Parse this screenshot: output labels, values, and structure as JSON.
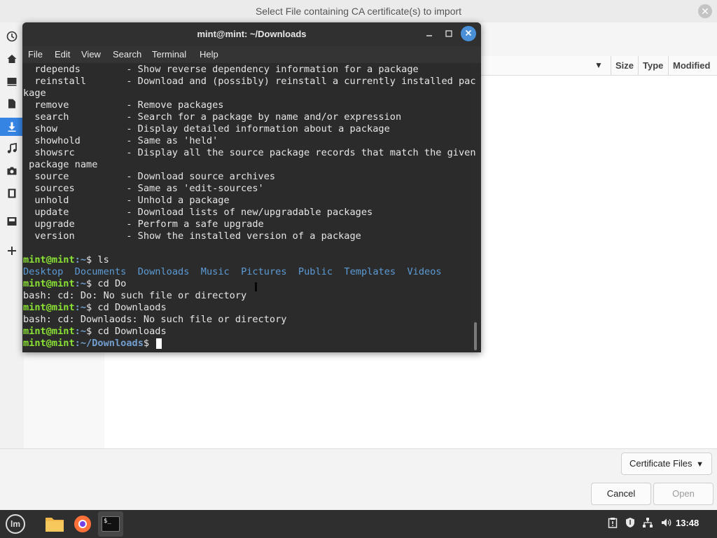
{
  "file_dialog": {
    "title": "Select File containing CA certificate(s) to import",
    "close_glyph": "✕",
    "sidebar_icons": [
      "recent-icon",
      "home-icon",
      "desktop-icon",
      "documents-icon",
      "downloads-icon",
      "music-icon",
      "pictures-icon",
      "videos-icon",
      "drive-icon",
      "plus-icon"
    ],
    "sidebar_active_index": 4,
    "columns": [
      "Size",
      "Type",
      "Modified"
    ],
    "filter_label": "Certificate Files",
    "cancel_label": "Cancel",
    "open_label": "Open"
  },
  "terminal": {
    "title": "mint@mint: ~/Downloads",
    "menu": [
      "File",
      "Edit",
      "View",
      "Search",
      "Terminal",
      "Help"
    ],
    "lines": [
      [
        {
          "t": "  rdepends        - Show reverse dependency information for a package",
          "c": ""
        }
      ],
      [
        {
          "t": "  reinstall       - Download and (possibly) reinstall a currently installed pac",
          "c": ""
        }
      ],
      [
        {
          "t": "kage",
          "c": ""
        }
      ],
      [
        {
          "t": "  remove          - Remove packages",
          "c": ""
        }
      ],
      [
        {
          "t": "  search          - Search for a package by name and/or expression",
          "c": ""
        }
      ],
      [
        {
          "t": "  show            - Display detailed information about a package",
          "c": ""
        }
      ],
      [
        {
          "t": "  showhold        - Same as 'held'",
          "c": ""
        }
      ],
      [
        {
          "t": "  showsrc         - Display all the source package records that match the given",
          "c": ""
        }
      ],
      [
        {
          "t": " package name",
          "c": ""
        }
      ],
      [
        {
          "t": "  source          - Download source archives",
          "c": ""
        }
      ],
      [
        {
          "t": "  sources         - Same as 'edit-sources'",
          "c": ""
        }
      ],
      [
        {
          "t": "  unhold          - Unhold a package",
          "c": ""
        }
      ],
      [
        {
          "t": "  update          - Download lists of new/upgradable packages",
          "c": ""
        }
      ],
      [
        {
          "t": "  upgrade         - Perform a safe upgrade",
          "c": ""
        }
      ],
      [
        {
          "t": "  version         - Show the installed version of a package",
          "c": ""
        }
      ],
      [],
      [
        {
          "t": "mint@mint",
          "c": "g"
        },
        {
          "t": ":~",
          "c": "b"
        },
        {
          "t": "$ ls",
          "c": ""
        }
      ],
      [
        {
          "t": "Desktop",
          "c": "d"
        },
        {
          "t": "  ",
          "c": ""
        },
        {
          "t": "Documents",
          "c": "d"
        },
        {
          "t": "  ",
          "c": ""
        },
        {
          "t": "Downloads",
          "c": "d"
        },
        {
          "t": "  ",
          "c": ""
        },
        {
          "t": "Music",
          "c": "d"
        },
        {
          "t": "  ",
          "c": ""
        },
        {
          "t": "Pictures",
          "c": "d"
        },
        {
          "t": "  ",
          "c": ""
        },
        {
          "t": "Public",
          "c": "d"
        },
        {
          "t": "  ",
          "c": ""
        },
        {
          "t": "Templates",
          "c": "d"
        },
        {
          "t": "  ",
          "c": ""
        },
        {
          "t": "Videos",
          "c": "d"
        }
      ],
      [
        {
          "t": "mint@mint",
          "c": "g"
        },
        {
          "t": ":~",
          "c": "b"
        },
        {
          "t": "$ cd Do",
          "c": ""
        }
      ],
      [
        {
          "t": "bash: cd: Do: No such file or directory",
          "c": ""
        }
      ],
      [
        {
          "t": "mint@mint",
          "c": "g"
        },
        {
          "t": ":~",
          "c": "b"
        },
        {
          "t": "$ cd Downlaods",
          "c": ""
        }
      ],
      [
        {
          "t": "bash: cd: Downlaods: No such file or directory",
          "c": ""
        }
      ],
      [
        {
          "t": "mint@mint",
          "c": "g"
        },
        {
          "t": ":~",
          "c": "b"
        },
        {
          "t": "$ cd Downloads",
          "c": ""
        }
      ],
      [
        {
          "t": "mint@mint",
          "c": "g"
        },
        {
          "t": ":~/Downloads",
          "c": "b"
        },
        {
          "t": "$ ",
          "c": ""
        }
      ]
    ]
  },
  "taskbar": {
    "clock": "13:48",
    "launchers": [
      "mint-menu",
      "files",
      "firefox",
      "terminal"
    ],
    "tray": [
      "clipboard-icon",
      "shield-icon",
      "network-icon",
      "volume-icon"
    ],
    "terminal_glyph": "$_"
  }
}
